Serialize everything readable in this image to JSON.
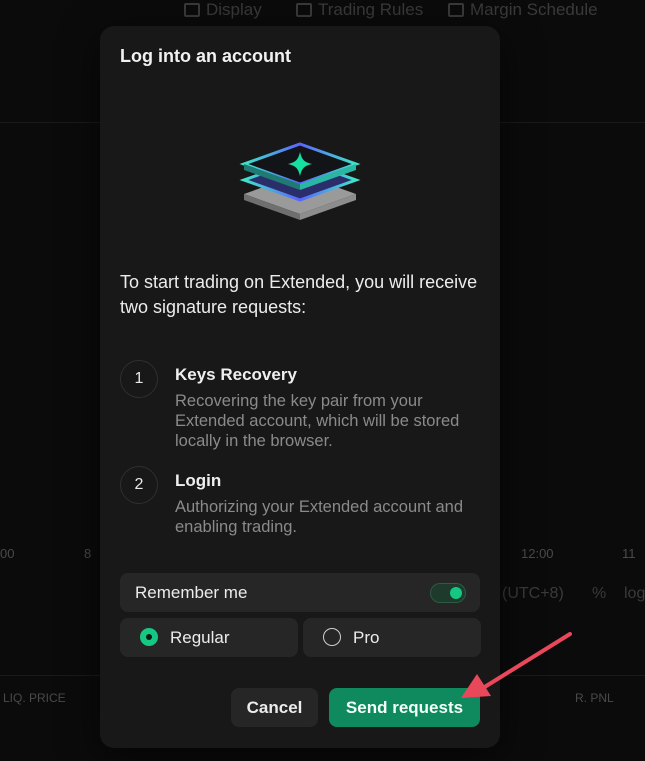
{
  "background": {
    "nav": [
      "Display",
      "Trading Rules",
      "Margin Schedule"
    ],
    "axis_labels": [
      "00",
      "8",
      "12:00",
      "11"
    ],
    "right_labels": [
      "(UTC+8)",
      "%",
      "log"
    ],
    "footer_left": "LIQ. PRICE",
    "footer_right": "R. PNL"
  },
  "modal": {
    "title": "Log into an account",
    "intro": "To start trading on Extended, you will receive two signature requests:",
    "steps": [
      {
        "num": "1",
        "title": "Keys Recovery",
        "desc": "Recovering the key pair from your Extended account, which will be stored locally in the browser."
      },
      {
        "num": "2",
        "title": "Login",
        "desc": "Authorizing your Extended account and enabling trading."
      }
    ],
    "remember_label": "Remember me",
    "remember_on": true,
    "options": [
      {
        "label": "Regular",
        "selected": true
      },
      {
        "label": "Pro",
        "selected": false
      }
    ],
    "cancel_label": "Cancel",
    "send_label": "Send requests"
  },
  "colors": {
    "accent": "#16c784",
    "send_button": "#0f8a5f",
    "arrow": "#e8485a"
  }
}
